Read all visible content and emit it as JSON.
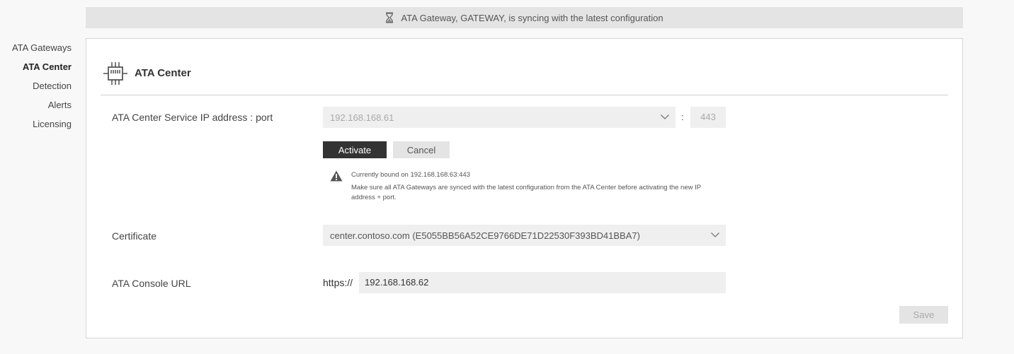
{
  "banner": {
    "message": "ATA Gateway, GATEWAY, is syncing with the latest configuration",
    "icon": "hourglass-icon"
  },
  "sidebar": {
    "items": [
      {
        "label": "ATA Gateways",
        "active": false
      },
      {
        "label": "ATA Center",
        "active": true
      },
      {
        "label": "Detection",
        "active": false
      },
      {
        "label": "Alerts",
        "active": false
      },
      {
        "label": "Licensing",
        "active": false
      }
    ]
  },
  "panel": {
    "title": "ATA Center",
    "icon": "chip-icon",
    "ip_port": {
      "label": "ATA Center Service IP address : port",
      "ip_value": "192.168.168.61",
      "separator": ":",
      "port_value": "443",
      "activate_label": "Activate",
      "cancel_label": "Cancel",
      "warning_line1": "Currently bound on 192.168.168.63:443",
      "warning_line2": "Make sure all ATA Gateways are synced with the latest configuration from the ATA Center before activating the new IP address + port."
    },
    "certificate": {
      "label": "Certificate",
      "value": "center.contoso.com (E5055BB56A52CE9766DE71D22530F393BD41BBA7)"
    },
    "console_url": {
      "label": "ATA Console URL",
      "prefix": "https://",
      "value": "192.168.168.62"
    },
    "save_label": "Save"
  },
  "colors": {
    "background": "#f8f8f8",
    "banner": "#e4e4e4",
    "primary_button": "#333333",
    "input_background": "#efefef"
  }
}
